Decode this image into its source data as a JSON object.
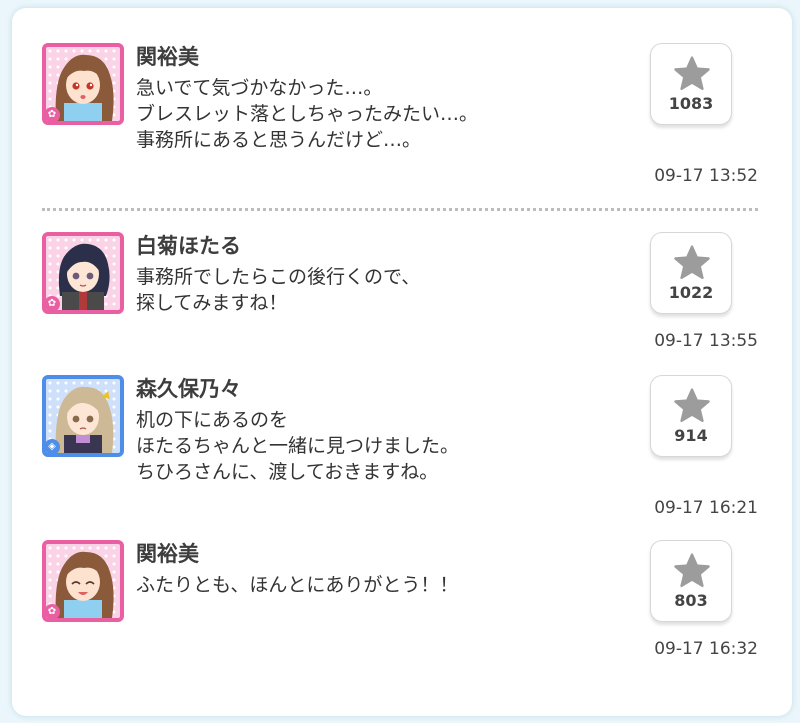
{
  "colors": {
    "cute": "#ea5fa2",
    "cool": "#4f8ee8",
    "star": "#9c9c9c"
  },
  "messages": [
    {
      "name": "関裕美",
      "lines": [
        "急いでて気づかなかった…。",
        "ブレスレット落としちゃったみたい…。",
        "事務所にあると思うんだけど…。"
      ],
      "likes": "1083",
      "time": "09-17 13:52"
    },
    {
      "name": "白菊ほたる",
      "lines": [
        "事務所でしたらこの後行くので、",
        "探してみますね！"
      ],
      "likes": "1022",
      "time": "09-17 13:55"
    },
    {
      "name": "森久保乃々",
      "lines": [
        "机の下にあるのを",
        "ほたるちゃんと一緒に見つけました。",
        "ちひろさんに、渡しておきますね。"
      ],
      "likes": "914",
      "time": "09-17 16:21"
    },
    {
      "name": "関裕美",
      "lines": [
        "ふたりとも、ほんとにありがとう！！"
      ],
      "likes": "803",
      "time": "09-17 16:32"
    }
  ]
}
